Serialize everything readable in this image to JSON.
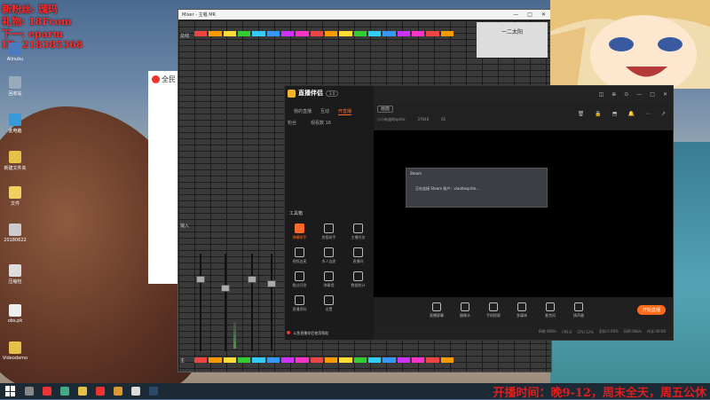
{
  "overlay": {
    "lines": [
      "新粉丝: 瑰玛",
      "礼物: 18Fcom",
      "下一: eparm",
      "ID: 218385368"
    ],
    "color": "#ff2a2a"
  },
  "desktop": {
    "icons": [
      {
        "label": "Alinuku",
        "name": "desktop-icon-1"
      },
      {
        "label": "回收站",
        "name": "desktop-icon-recycle"
      },
      {
        "label": "此电脑",
        "name": "desktop-icon-computer"
      },
      {
        "label": "新建文件夹",
        "name": "desktop-icon-folder"
      },
      {
        "label": "文件",
        "name": "desktop-icon-file"
      },
      {
        "label": "20180622",
        "name": "desktop-icon-date"
      },
      {
        "label": "压缩包",
        "name": "desktop-icon-archive"
      },
      {
        "label": "obs.pk",
        "name": "desktop-icon-obs"
      },
      {
        "label": "Videodemo",
        "name": "desktop-icon-video"
      }
    ]
  },
  "mixer": {
    "title": "Mixer - 主唱 MR",
    "window_controls": [
      "—",
      "□",
      "✕"
    ],
    "clock_label": "一二太阳",
    "side_labels": [
      "总线",
      "输入",
      "主"
    ],
    "channel_colors": [
      "#e44",
      "#f90",
      "#fd3",
      "#3c3",
      "#3cf",
      "#39f",
      "#c3f",
      "#f3c",
      "#e44",
      "#f90",
      "#fd3",
      "#3c3",
      "#3cf",
      "#39f",
      "#c3f",
      "#f3c",
      "#e44",
      "#f90"
    ]
  },
  "small_window": {
    "title": "全民"
  },
  "app": {
    "logo_text": "直播伴侣",
    "version": "3.0",
    "tabs": [
      {
        "label": "我的直播",
        "active": false
      },
      {
        "label": "互动",
        "active": false
      },
      {
        "label": "开直播",
        "active": true
      }
    ],
    "stats": [
      "粉丝",
      "观看数 16"
    ],
    "scene_pill": "画面",
    "room": {
      "name": "小小街道的sprite",
      "likes": "37048",
      "fans": "65"
    },
    "tools_title": "工具箱",
    "tools": [
      {
        "label": "弹幕助手",
        "active": true,
        "name": "tool-danmu"
      },
      {
        "label": "房管助手",
        "active": false,
        "name": "tool-admin"
      },
      {
        "label": "主播任务",
        "active": false,
        "name": "tool-task"
      },
      {
        "label": "视频连麦",
        "active": false,
        "name": "tool-video"
      },
      {
        "label": "多人连麦",
        "active": false,
        "name": "tool-multi"
      },
      {
        "label": "直播间",
        "active": false,
        "name": "tool-room"
      },
      {
        "label": "跳过问答",
        "active": false,
        "name": "tool-skip"
      },
      {
        "label": "弹幕墙",
        "active": false,
        "name": "tool-wall"
      },
      {
        "label": "数据统计",
        "active": false,
        "name": "tool-stats"
      },
      {
        "label": "直播资料",
        "active": false,
        "name": "tool-info"
      },
      {
        "label": "设置",
        "active": false,
        "name": "tool-settings"
      }
    ],
    "notice": "斗鱼直播伴侣使用帮助",
    "steam_dialog": {
      "title": "Steam",
      "message": "正在连接 Steam 账户：xiaotiesprite..."
    },
    "bottom_tools": [
      {
        "label": "直播屏幕",
        "name": "screen-capture"
      },
      {
        "label": "摄像头",
        "name": "camera"
      },
      {
        "label": "手机投屏",
        "name": "phone-cast"
      },
      {
        "label": "多媒体",
        "name": "media"
      },
      {
        "label": "麦克风",
        "name": "microphone"
      },
      {
        "label": "扬声器",
        "name": "speaker"
      }
    ],
    "start_button": "开始直播",
    "status": [
      "网络 0KB/s",
      "FPS:0",
      "CPU:12%",
      "丢帧:0.00%",
      "码率:0kb/s",
      "时长:00:00"
    ],
    "top_icons": [
      "◫",
      "⊕",
      "⊙",
      "—",
      "□",
      "✕"
    ],
    "right_icons": [
      "🗑",
      "🔒",
      "⬒",
      "🔔",
      "⋯",
      "↗"
    ]
  },
  "taskbar": {
    "ticker": "开播时间：晚9-12，周末全天，周五公休"
  }
}
